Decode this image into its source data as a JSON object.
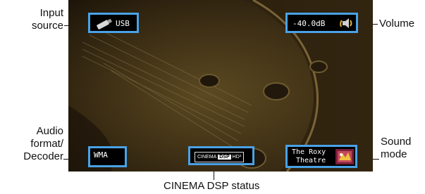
{
  "screen": {
    "input_source": "USB",
    "volume": "-40.0dB",
    "audio_format": "WMA",
    "cinema_dsp_label": "CINEMA",
    "cinema_dsp_badge": "DSP",
    "cinema_dsp_hd": "HD³",
    "sound_mode_line1": "The Roxy",
    "sound_mode_line2": "Theatre"
  },
  "callouts": {
    "input_source_line1": "Input",
    "input_source_line2": "source",
    "volume": "Volume",
    "audio_format_line1": "Audio",
    "audio_format_line2": "format/",
    "audio_format_line3": "Decoder",
    "sound_mode_line1": "Sound",
    "sound_mode_line2": "mode",
    "cinema_dsp_status": "CINEMA DSP status"
  },
  "colors": {
    "osd_border": "#4aa2e6",
    "osd_background": "#000000",
    "dsp_badge": "#ffffff"
  },
  "icons": {
    "input_source": "usb-stick-icon",
    "volume": "speaker-icon",
    "sound_mode": "theatre-icon"
  }
}
